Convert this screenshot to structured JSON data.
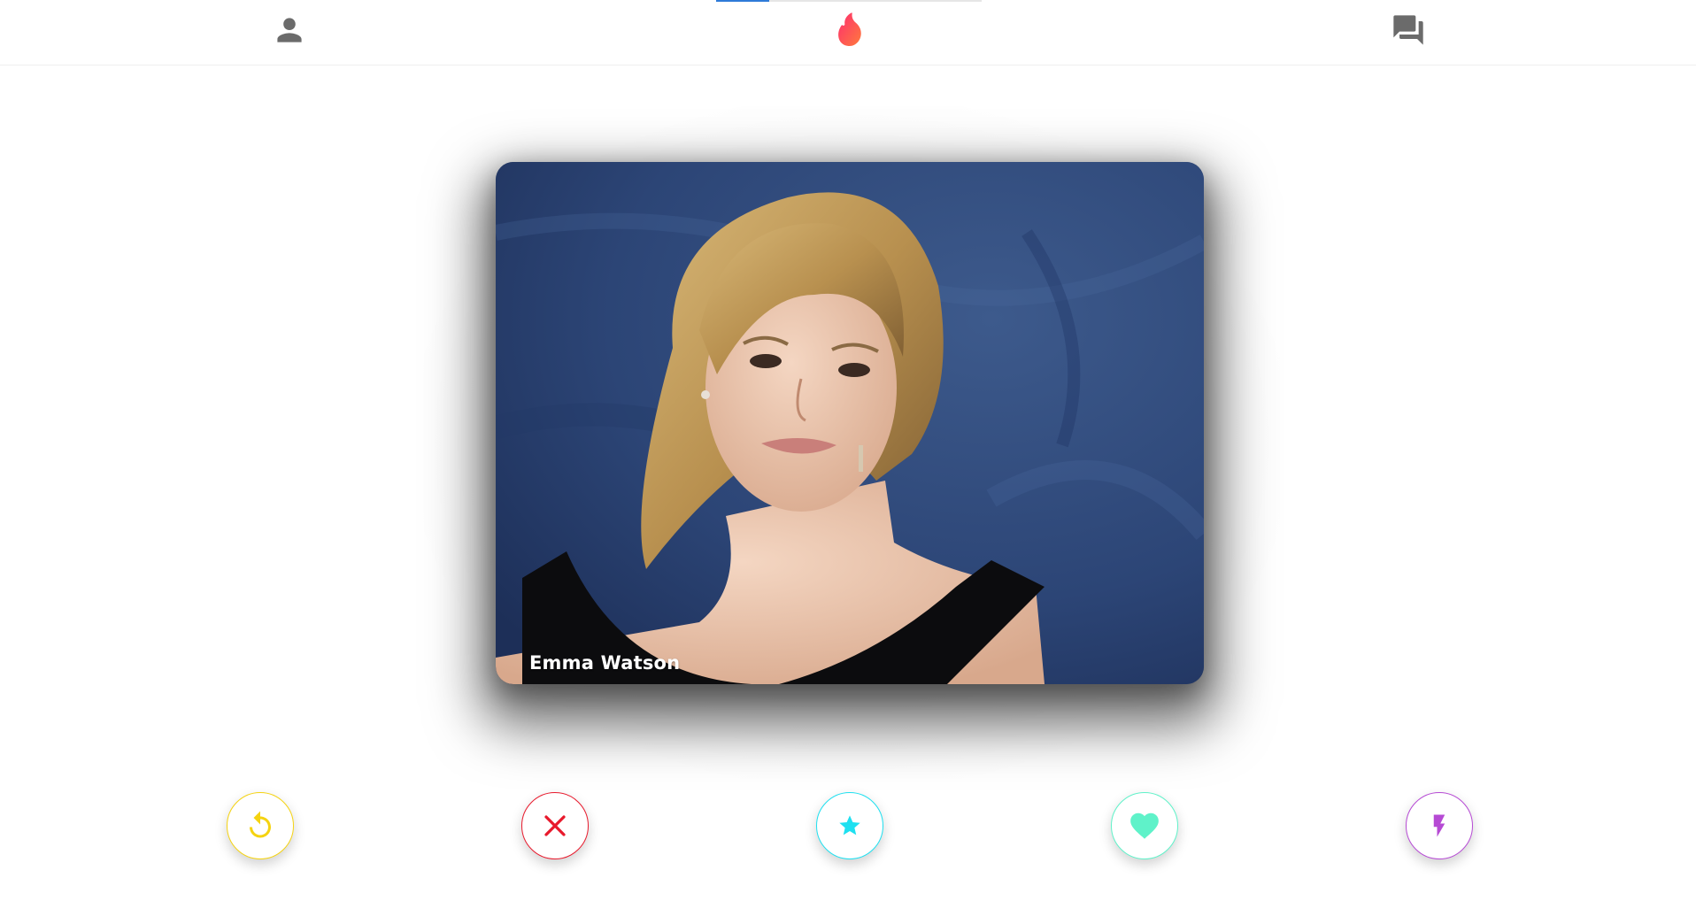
{
  "header": {
    "profile_icon": "person-icon",
    "logo_icon": "flame-icon",
    "messages_icon": "chat-bubbles-icon",
    "progress": 0.2
  },
  "card": {
    "name": "Emma Watson"
  },
  "actions": [
    {
      "id": "rewind",
      "icon": "rewind-icon",
      "color": "#f5d311"
    },
    {
      "id": "nope",
      "icon": "close-icon",
      "color": "#e8192c"
    },
    {
      "id": "super-like",
      "icon": "star-icon",
      "color": "#1ee0f0"
    },
    {
      "id": "like",
      "icon": "heart-icon",
      "color": "#5ff2c9"
    },
    {
      "id": "boost",
      "icon": "lightning-icon",
      "color": "#b64ad4"
    }
  ],
  "colors": {
    "brand": "#fe4a5a",
    "icon_gray": "#6b6b6b"
  }
}
